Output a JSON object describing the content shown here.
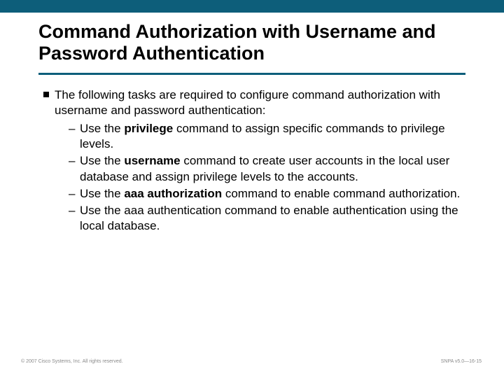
{
  "title": "Command Authorization with Username and Password Authentication",
  "lead": "The following tasks are required to configure command authorization with username and password authentication:",
  "items": [
    {
      "pre": "Use the ",
      "bold": "privilege",
      "post": " command to assign specific commands to privilege levels."
    },
    {
      "pre": "Use the ",
      "bold": "username",
      "post": " command to create user accounts in the local user database and assign privilege levels to the accounts."
    },
    {
      "pre": "Use the ",
      "bold": "aaa authorization",
      "post": " command to enable command authorization."
    },
    {
      "pre": "Use the aaa authentication command to enable authentication using the local database.",
      "bold": "",
      "post": ""
    }
  ],
  "footer": {
    "left": "© 2007 Cisco Systems, Inc. All rights reserved.",
    "right": "SNPA v5.0—16-15"
  }
}
